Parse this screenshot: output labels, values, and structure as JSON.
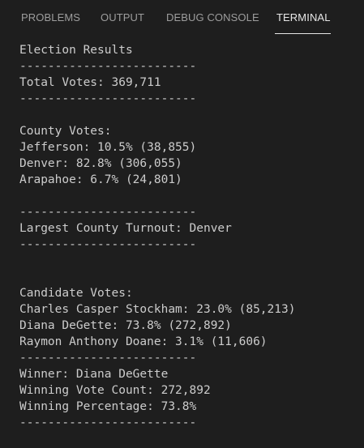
{
  "tabs": [
    {
      "label": "PROBLEMS",
      "active": false
    },
    {
      "label": "OUTPUT",
      "active": false
    },
    {
      "label": "DEBUG CONSOLE",
      "active": false
    },
    {
      "label": "TERMINAL",
      "active": true
    }
  ],
  "colors": {
    "background": "#1e1e1e",
    "text": "#cccccc",
    "tab_inactive": "#9d9d9d",
    "tab_active": "#e7e7e7"
  },
  "terminal": {
    "lines": [
      "Election Results",
      "-------------------------",
      "Total Votes: 369,711",
      "-------------------------",
      "",
      "County Votes:",
      "Jefferson: 10.5% (38,855)",
      "Denver: 82.8% (306,055)",
      "Arapahoe: 6.7% (24,801)",
      "",
      "-------------------------",
      "Largest County Turnout: Denver",
      "-------------------------",
      "",
      "",
      "Candidate Votes:",
      "Charles Casper Stockham: 23.0% (85,213)",
      "Diana DeGette: 73.8% (272,892)",
      "Raymon Anthony Doane: 3.1% (11,606)",
      "-------------------------",
      "Winner: Diana DeGette",
      "Winning Vote Count: 272,892",
      "Winning Percentage: 73.8%",
      "-------------------------"
    ]
  }
}
